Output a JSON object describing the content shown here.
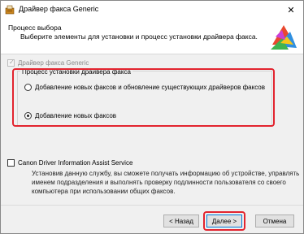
{
  "window": {
    "title": "Драйвер факса Generic",
    "close_glyph": "✕"
  },
  "header": {
    "title": "Процесс выбора",
    "subtitle": "Выберите элементы для установки и процесс установки драйвера факса."
  },
  "components": {
    "driver_label": "Драйвер факса Generic",
    "driver_checked": true,
    "driver_disabled": true
  },
  "install_process": {
    "legend": "Процесс установки драйвера факса",
    "options": [
      {
        "label": "Добавление новых факсов и обновление существующих драйверов факсов",
        "selected": false
      },
      {
        "label": "Добавление новых факсов",
        "selected": true
      }
    ]
  },
  "assist_service": {
    "label": "Canon Driver Information Assist Service",
    "checked": false,
    "description": "Установив данную службу, вы сможете получать информацию об устройстве, управлять именем подразделения и выполнять проверку подлинности пользователя со своего компьютера при использовании общих факсов."
  },
  "buttons": {
    "back": "< Назад",
    "next": "Далее >",
    "cancel": "Отмена"
  },
  "colors": {
    "highlight": "#e2242f",
    "default_button_border": "#0078d7"
  }
}
